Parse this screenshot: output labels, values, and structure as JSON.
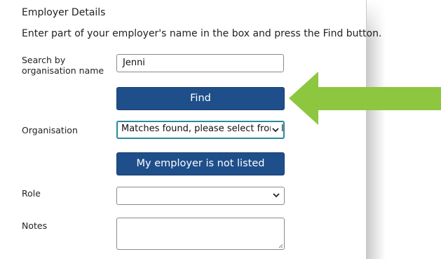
{
  "section": {
    "title": "Employer Details",
    "instructions": "Enter part of your employer's name in the box and press the Find button."
  },
  "search": {
    "label_line1": "Search by",
    "label_line2": "organisation name",
    "value": "Jenni"
  },
  "find_button": {
    "label": "Find"
  },
  "organisation": {
    "label": "Organisation",
    "selected": "Matches found, please select from list"
  },
  "not_listed_button": {
    "label": "My employer is not listed"
  },
  "role": {
    "label": "Role",
    "selected": ""
  },
  "notes": {
    "label": "Notes",
    "value": ""
  },
  "colors": {
    "button_bg": "#1e4f8a",
    "focus_border": "#2a8a9c",
    "arrow": "#8dc63f"
  },
  "icons": {
    "dropdown": "chevron-down-icon",
    "resize": "resize-grip-icon",
    "pointer": "green-arrow-pointer"
  }
}
